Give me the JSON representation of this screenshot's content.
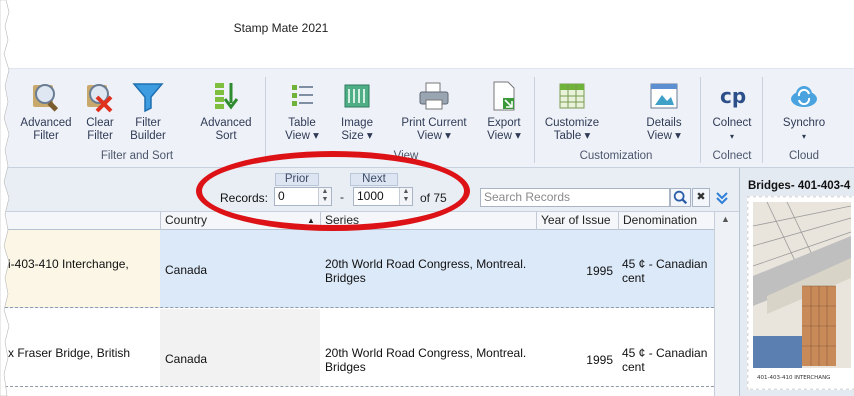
{
  "window": {
    "title": "Stamp Mate 2021"
  },
  "ribbon": {
    "buttons": [
      {
        "id": "advanced-filter",
        "line1": "Advanced",
        "line2": "Filter"
      },
      {
        "id": "clear-filter",
        "line1": "Clear",
        "line2": "Filter"
      },
      {
        "id": "filter-builder",
        "line1": "Filter",
        "line2": "Builder"
      },
      {
        "id": "advanced-sort",
        "line1": "Advanced",
        "line2": "Sort"
      },
      {
        "id": "table-view",
        "line1": "Table",
        "line2": "View ▾"
      },
      {
        "id": "image-size",
        "line1": "Image",
        "line2": "Size ▾"
      },
      {
        "id": "print-current-view",
        "line1": "Print Current",
        "line2": "View ▾"
      },
      {
        "id": "export-view",
        "line1": "Export",
        "line2": "View ▾"
      },
      {
        "id": "customize-table",
        "line1": "Customize",
        "line2": "Table ▾"
      },
      {
        "id": "details-view",
        "line1": "Details",
        "line2": "View ▾"
      },
      {
        "id": "colnect",
        "line1": "Colnect",
        "line2": "▾"
      },
      {
        "id": "synchro",
        "line1": "Synchro",
        "line2": "▾"
      }
    ],
    "groups": {
      "filter_sort": "Filter and Sort",
      "view": "View",
      "customization": "Customization",
      "colnect": "Colnect",
      "cloud": "Cloud"
    }
  },
  "toolbar": {
    "prior_label": "Prior",
    "next_label": "Next",
    "records_label": "Records:",
    "from_value": "0",
    "to_value": "1000",
    "separator": "-",
    "total_text": "of 75",
    "search_placeholder": "Search Records"
  },
  "table": {
    "columns": [
      "Country",
      "Series",
      "Year of Issue",
      "Denomination"
    ],
    "rows": [
      {
        "name": "i-403-410 Interchange,",
        "country": "Canada",
        "series_line1": "20th World Road Congress, Montreal.",
        "series_line2": "Bridges",
        "year": "1995",
        "denom_line1": "45 ¢ - Canadian",
        "denom_line2": "cent"
      },
      {
        "name": "x Fraser Bridge, British",
        "country": "Canada",
        "series_line1": "20th World Road Congress, Montreal.",
        "series_line2": "Bridges",
        "year": "1995",
        "denom_line1": "45 ¢ - Canadian",
        "denom_line2": "cent"
      }
    ]
  },
  "details": {
    "title": "Bridges- 401-403-4",
    "stamp_caption": "401-403-410 INTERCHANG"
  },
  "colors": {
    "ribbon_bg": "#eef2f8",
    "row_selected": "#dce9f9",
    "row_name_bg": "#fbf6e5",
    "highlight_oval": "#dd1216"
  }
}
